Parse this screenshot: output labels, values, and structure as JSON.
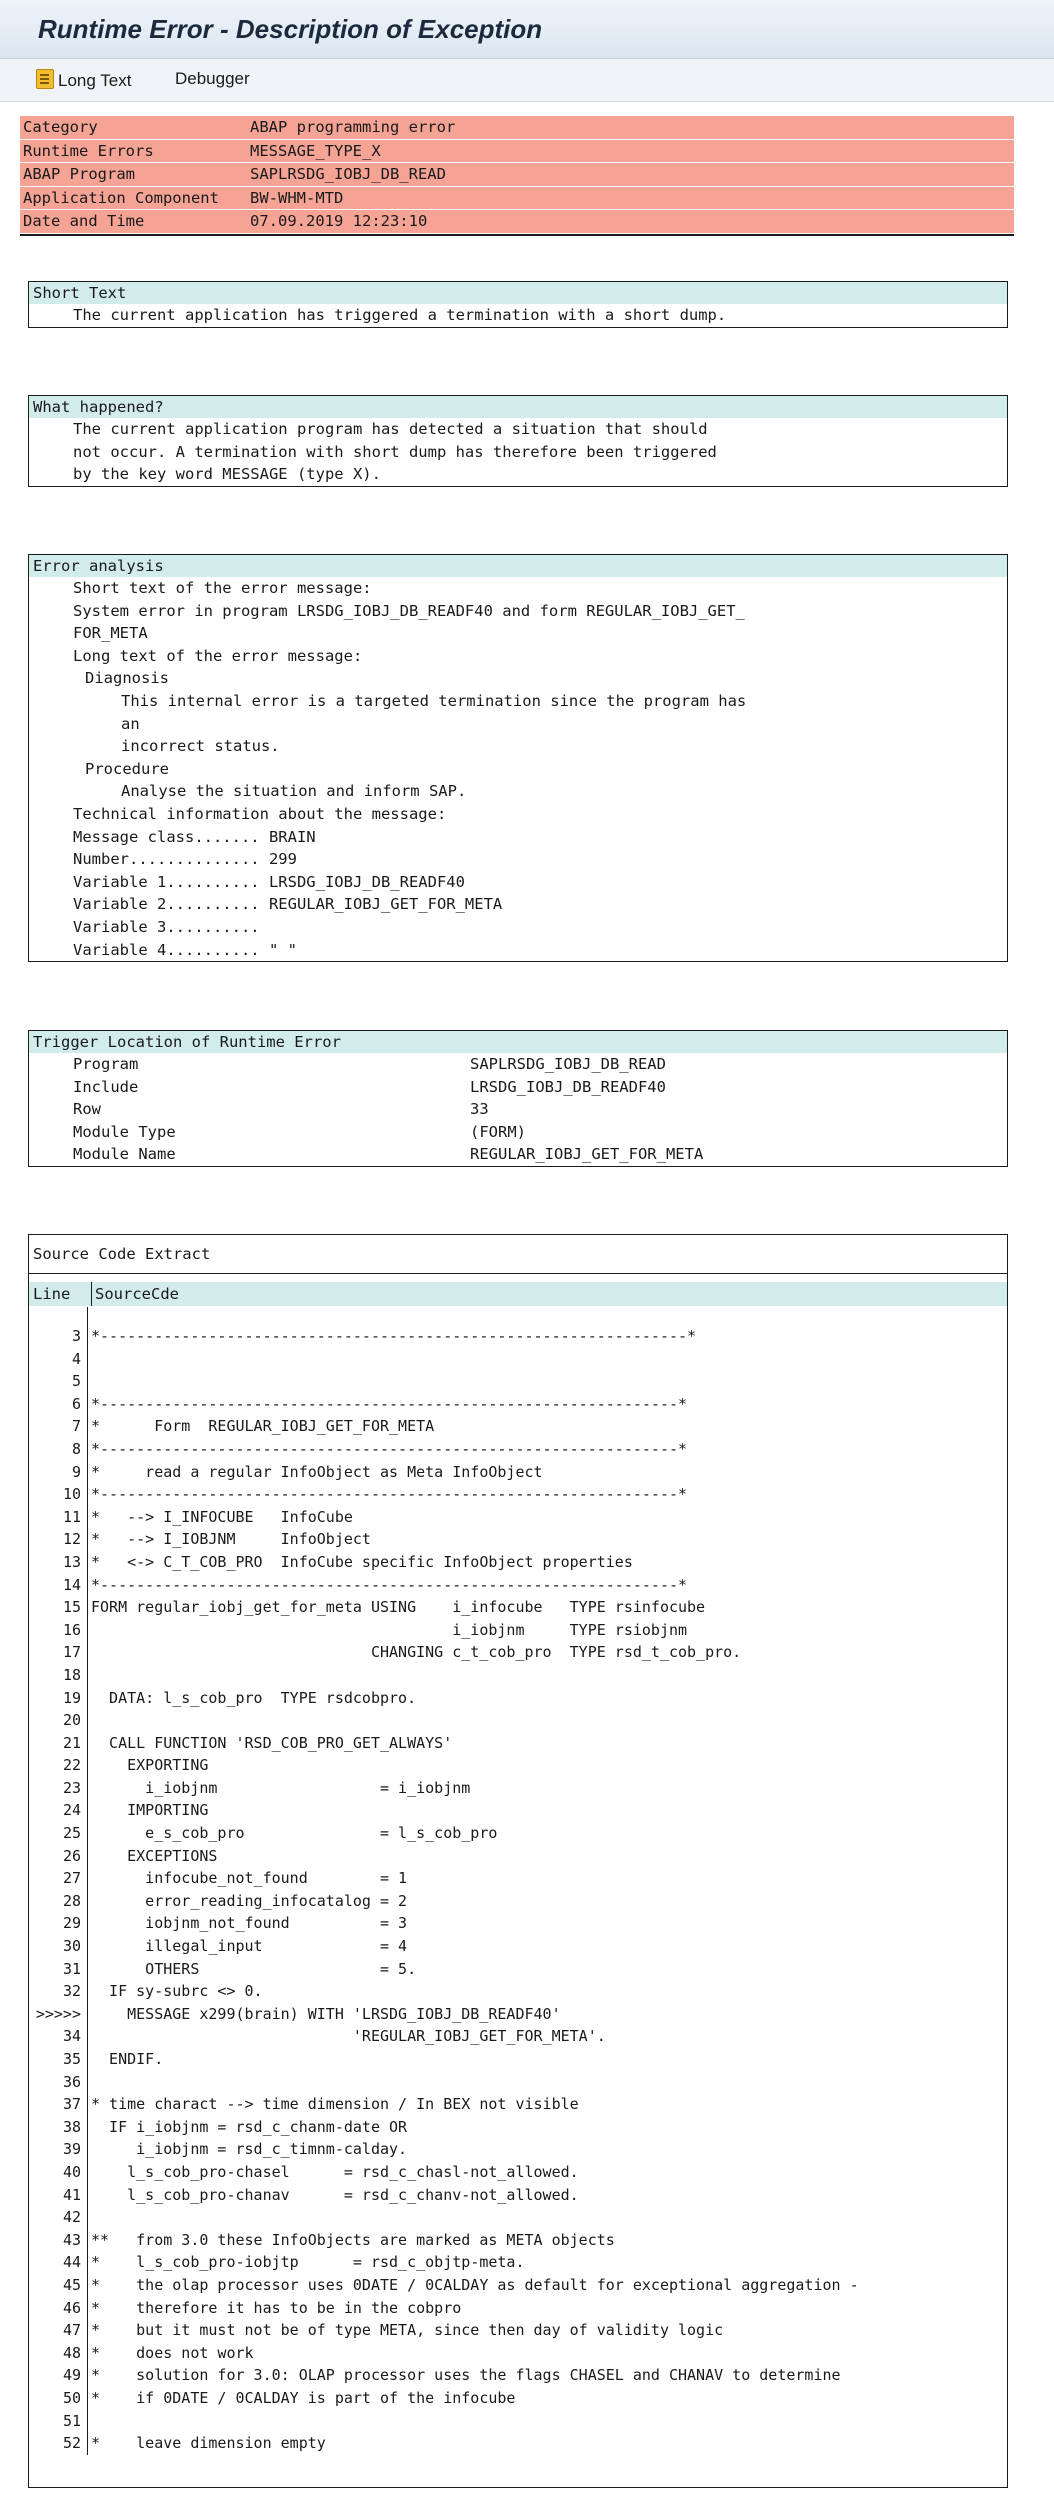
{
  "window": {
    "title": "Runtime Error - Description of Exception"
  },
  "toolbar": {
    "long_text": "Long Text",
    "debugger": "Debugger"
  },
  "header_rows": [
    {
      "key": "Category",
      "value": "ABAP programming error"
    },
    {
      "key": "Runtime Errors",
      "value": "MESSAGE_TYPE_X"
    },
    {
      "key": "ABAP Program",
      "value": "SAPLRSDG_IOBJ_DB_READ"
    },
    {
      "key": "Application Component",
      "value": "BW-WHM-MTD"
    },
    {
      "key": "Date and Time",
      "value": "07.09.2019 12:23:10"
    }
  ],
  "short_text": {
    "heading": "Short Text",
    "lines": [
      "The current application has triggered a termination with a short dump."
    ]
  },
  "what_happened": {
    "heading": "What happened?",
    "lines": [
      "The current application program has detected a situation that should",
      "not occur. A termination with short dump has therefore been triggered",
      "by the key word MESSAGE (type X)."
    ]
  },
  "error_analysis": {
    "heading": "Error analysis",
    "lines": [
      "Short text of the error message:",
      "System error in program LRSDG_IOBJ_DB_READF40 and form REGULAR_IOBJ_GET_",
      "FOR_META",
      "Long text of the error message:",
      "Diagnosis",
      "This internal error is a targeted termination since the program has",
      "an",
      "incorrect status.",
      "Procedure",
      "Analyse the situation and inform SAP.",
      "Technical information about the message:",
      "Message class....... BRAIN",
      "Number.............. 299",
      "Variable 1.......... LRSDG_IOBJ_DB_READF40",
      "Variable 2.......... REGULAR_IOBJ_GET_FOR_META",
      "Variable 3..........",
      "Variable 4.......... \" \""
    ]
  },
  "trigger_location": {
    "heading": "Trigger Location of Runtime Error",
    "rows": [
      {
        "key": "Program",
        "value": "SAPLRSDG_IOBJ_DB_READ"
      },
      {
        "key": "Include",
        "value": "LRSDG_IOBJ_DB_READF40"
      },
      {
        "key": "Row",
        "value": "33"
      },
      {
        "key": "Module Type",
        "value": "(FORM)"
      },
      {
        "key": "Module Name",
        "value": "REGULAR_IOBJ_GET_FOR_META"
      }
    ]
  },
  "source_code": {
    "heading": "Source Code Extract",
    "col_line": "Line",
    "col_source": "SourceCde",
    "lines": [
      {
        "num": "3",
        "code": "*-----------------------------------------------------------------*"
      },
      {
        "num": "4",
        "code": ""
      },
      {
        "num": "5",
        "code": ""
      },
      {
        "num": "6",
        "code": "*----------------------------------------------------------------*"
      },
      {
        "num": "7",
        "code": "*      Form  REGULAR_IOBJ_GET_FOR_META"
      },
      {
        "num": "8",
        "code": "*----------------------------------------------------------------*"
      },
      {
        "num": "9",
        "code": "*     read a regular InfoObject as Meta InfoObject"
      },
      {
        "num": "10",
        "code": "*----------------------------------------------------------------*"
      },
      {
        "num": "11",
        "code": "*   --> I_INFOCUBE   InfoCube"
      },
      {
        "num": "12",
        "code": "*   --> I_IOBJNM     InfoObject"
      },
      {
        "num": "13",
        "code": "*   <-> C_T_COB_PRO  InfoCube specific InfoObject properties"
      },
      {
        "num": "14",
        "code": "*----------------------------------------------------------------*"
      },
      {
        "num": "15",
        "code": "FORM regular_iobj_get_for_meta USING    i_infocube   TYPE rsinfocube"
      },
      {
        "num": "16",
        "code": "                                        i_iobjnm     TYPE rsiobjnm"
      },
      {
        "num": "17",
        "code": "                               CHANGING c_t_cob_pro  TYPE rsd_t_cob_pro."
      },
      {
        "num": "18",
        "code": ""
      },
      {
        "num": "19",
        "code": "  DATA: l_s_cob_pro  TYPE rsdcobpro."
      },
      {
        "num": "20",
        "code": ""
      },
      {
        "num": "21",
        "code": "  CALL FUNCTION 'RSD_COB_PRO_GET_ALWAYS'"
      },
      {
        "num": "22",
        "code": "    EXPORTING"
      },
      {
        "num": "23",
        "code": "      i_iobjnm                  = i_iobjnm"
      },
      {
        "num": "24",
        "code": "    IMPORTING"
      },
      {
        "num": "25",
        "code": "      e_s_cob_pro               = l_s_cob_pro"
      },
      {
        "num": "26",
        "code": "    EXCEPTIONS"
      },
      {
        "num": "27",
        "code": "      infocube_not_found        = 1"
      },
      {
        "num": "28",
        "code": "      error_reading_infocatalog = 2"
      },
      {
        "num": "29",
        "code": "      iobjnm_not_found          = 3"
      },
      {
        "num": "30",
        "code": "      illegal_input             = 4"
      },
      {
        "num": "31",
        "code": "      OTHERS                    = 5."
      },
      {
        "num": "32",
        "code": "  IF sy-subrc <> 0."
      },
      {
        "num": ">>>>>",
        "code": "    MESSAGE x299(brain) WITH 'LRSDG_IOBJ_DB_READF40'"
      },
      {
        "num": "34",
        "code": "                             'REGULAR_IOBJ_GET_FOR_META'."
      },
      {
        "num": "35",
        "code": "  ENDIF."
      },
      {
        "num": "36",
        "code": ""
      },
      {
        "num": "37",
        "code": "* time charact --> time dimension / In BEX not visible"
      },
      {
        "num": "38",
        "code": "  IF i_iobjnm = rsd_c_chanm-date OR"
      },
      {
        "num": "39",
        "code": "     i_iobjnm = rsd_c_timnm-calday."
      },
      {
        "num": "40",
        "code": "    l_s_cob_pro-chasel      = rsd_c_chasl-not_allowed."
      },
      {
        "num": "41",
        "code": "    l_s_cob_pro-chanav      = rsd_c_chanv-not_allowed."
      },
      {
        "num": "42",
        "code": ""
      },
      {
        "num": "43",
        "code": "**   from 3.0 these InfoObjects are marked as META objects"
      },
      {
        "num": "44",
        "code": "*    l_s_cob_pro-iobjtp      = rsd_c_objtp-meta."
      },
      {
        "num": "45",
        "code": "*    the olap processor uses 0DATE / 0CALDAY as default for exceptional aggregation -"
      },
      {
        "num": "46",
        "code": "*    therefore it has to be in the cobpro"
      },
      {
        "num": "47",
        "code": "*    but it must not be of type META, since then day of validity logic"
      },
      {
        "num": "48",
        "code": "*    does not work"
      },
      {
        "num": "49",
        "code": "*    solution for 3.0: OLAP processor uses the flags CHASEL and CHANAV to determine"
      },
      {
        "num": "50",
        "code": "*    if 0DATE / 0CALDAY is part of the infocube"
      },
      {
        "num": "51",
        "code": ""
      },
      {
        "num": "52",
        "code": "*    leave dimension empty"
      }
    ]
  }
}
